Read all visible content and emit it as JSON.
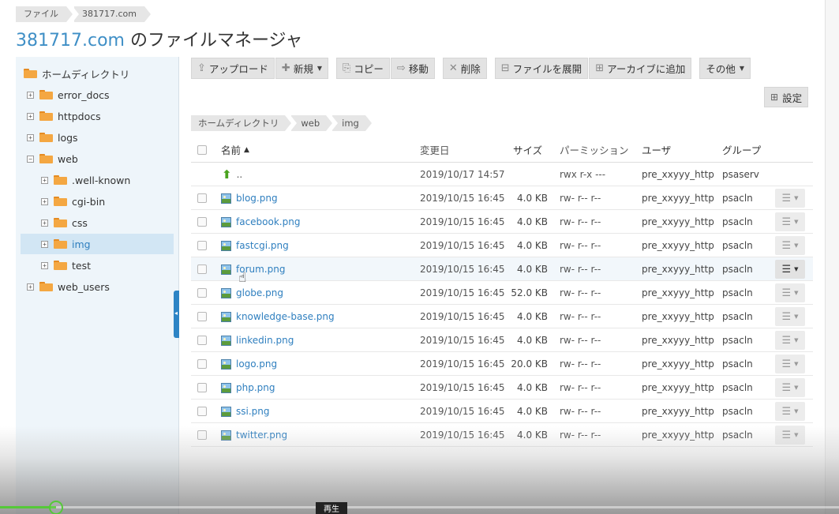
{
  "top_breadcrumb": [
    "ファイル",
    "381717.com"
  ],
  "title": {
    "domain": "381717.com",
    "suffix": " のファイルマネージャ"
  },
  "sidebar": {
    "items": [
      {
        "label": "ホームディレクトリ",
        "toggle": ""
      },
      {
        "label": "error_docs",
        "toggle": "+"
      },
      {
        "label": "httpdocs",
        "toggle": "+"
      },
      {
        "label": "logs",
        "toggle": "+"
      },
      {
        "label": "web",
        "toggle": "−"
      },
      {
        "label": ".well-known",
        "toggle": "+"
      },
      {
        "label": "cgi-bin",
        "toggle": "+"
      },
      {
        "label": "css",
        "toggle": "+"
      },
      {
        "label": "img",
        "toggle": "+"
      },
      {
        "label": "test",
        "toggle": "+"
      },
      {
        "label": "web_users",
        "toggle": "+"
      }
    ]
  },
  "toolbar": {
    "upload": "アップロード",
    "new": "新規",
    "copy": "コピー",
    "move": "移動",
    "delete": "削除",
    "extract": "ファイルを展開",
    "archive": "アーカイブに追加",
    "other": "その他",
    "settings": "設定"
  },
  "path_breadcrumb": [
    "ホームディレクトリ",
    "web",
    "img"
  ],
  "columns": {
    "name": "名前",
    "date": "変更日",
    "size": "サイズ",
    "perm": "パーミッション",
    "user": "ユーザ",
    "group": "グループ"
  },
  "parent_row": {
    "name": "..",
    "date": "2019/10/17 14:57",
    "size": "",
    "perm": "rwx r-x ---",
    "user": "pre_xxyyy_http",
    "group": "psaserv"
  },
  "files": [
    {
      "name": "blog.png",
      "date": "2019/10/15 16:45",
      "size": "4.0 KB",
      "perm": "rw- r-- r--",
      "user": "pre_xxyyy_http",
      "group": "psacln"
    },
    {
      "name": "facebook.png",
      "date": "2019/10/15 16:45",
      "size": "4.0 KB",
      "perm": "rw- r-- r--",
      "user": "pre_xxyyy_http",
      "group": "psacln"
    },
    {
      "name": "fastcgi.png",
      "date": "2019/10/15 16:45",
      "size": "4.0 KB",
      "perm": "rw- r-- r--",
      "user": "pre_xxyyy_http",
      "group": "psacln"
    },
    {
      "name": "forum.png",
      "date": "2019/10/15 16:45",
      "size": "4.0 KB",
      "perm": "rw- r-- r--",
      "user": "pre_xxyyy_http",
      "group": "psacln"
    },
    {
      "name": "globe.png",
      "date": "2019/10/15 16:45",
      "size": "52.0 KB",
      "perm": "rw- r-- r--",
      "user": "pre_xxyyy_http",
      "group": "psacln"
    },
    {
      "name": "knowledge-base.png",
      "date": "2019/10/15 16:45",
      "size": "4.0 KB",
      "perm": "rw- r-- r--",
      "user": "pre_xxyyy_http",
      "group": "psacln"
    },
    {
      "name": "linkedin.png",
      "date": "2019/10/15 16:45",
      "size": "4.0 KB",
      "perm": "rw- r-- r--",
      "user": "pre_xxyyy_http",
      "group": "psacln"
    },
    {
      "name": "logo.png",
      "date": "2019/10/15 16:45",
      "size": "20.0 KB",
      "perm": "rw- r-- r--",
      "user": "pre_xxyyy_http",
      "group": "psacln"
    },
    {
      "name": "php.png",
      "date": "2019/10/15 16:45",
      "size": "4.0 KB",
      "perm": "rw- r-- r--",
      "user": "pre_xxyyy_http",
      "group": "psacln"
    },
    {
      "name": "ssi.png",
      "date": "2019/10/15 16:45",
      "size": "4.0 KB",
      "perm": "rw- r-- r--",
      "user": "pre_xxyyy_http",
      "group": "psacln"
    },
    {
      "name": "twitter.png",
      "date": "2019/10/15 16:45",
      "size": "4.0 KB",
      "perm": "rw- r-- r--",
      "user": "pre_xxyyy_http",
      "group": "psacln"
    }
  ],
  "video": {
    "progress": 0.067,
    "tooltip": "再生"
  },
  "colors": {
    "accent": "#3f8fc6",
    "link": "#2f7fbf",
    "folder": "#f4a742",
    "progress": "#55c938"
  }
}
